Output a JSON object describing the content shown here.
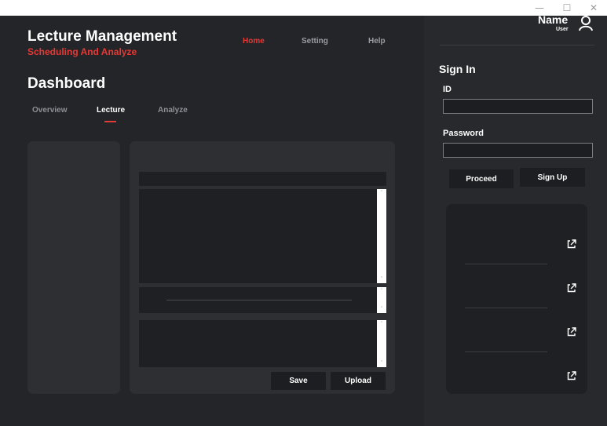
{
  "window": {
    "minimize_glyph": "—",
    "maximize_glyph": "☐",
    "close_glyph": "✕"
  },
  "header": {
    "title": "Lecture Management",
    "subtitle": "Scheduling And Analyze",
    "nav": {
      "home": "Home",
      "setting": "Setting",
      "help": "Help"
    }
  },
  "dashboard": {
    "title": "Dashboard",
    "tabs": {
      "overview": "Overview",
      "lecture": "Lecture",
      "analyze": "Analyze"
    }
  },
  "editor": {
    "save_label": "Save",
    "upload_label": "Upload",
    "scroll_up": "˄",
    "scroll_down": "˅"
  },
  "user": {
    "name": "Name",
    "role": "User"
  },
  "signin": {
    "title": "Sign In",
    "id_label": "ID",
    "password_label": "Password",
    "id_value": "",
    "password_value": "",
    "proceed_label": "Proceed",
    "signup_label": "Sign Up"
  },
  "colors": {
    "accent": "#e53935",
    "background": "#232528",
    "panel": "#2d2f33",
    "sidebar": "#28292d"
  },
  "icons": {
    "user": "user-icon",
    "external": "external-link-icon"
  }
}
